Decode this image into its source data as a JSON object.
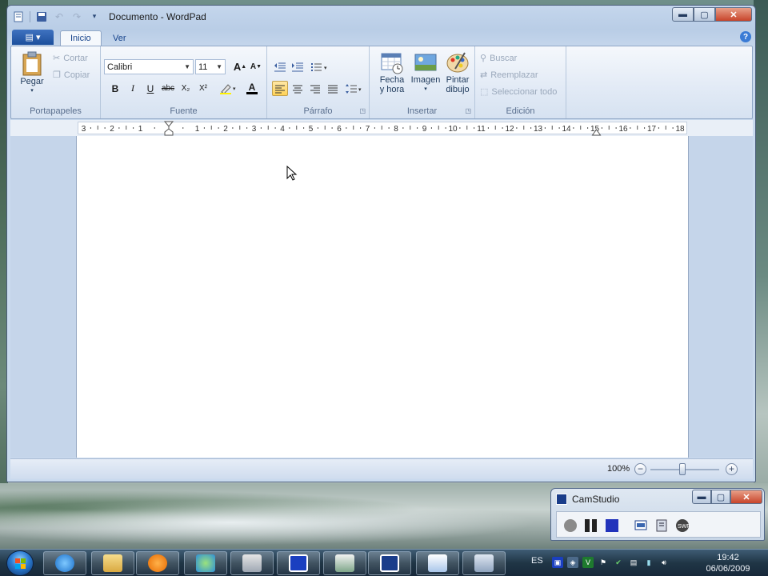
{
  "window": {
    "title": "Documento - WordPad",
    "controls": {
      "minimize": "▬",
      "maximize": "▢",
      "close": "✕"
    }
  },
  "quick_access": {
    "icons": [
      "wordpad-app-icon",
      "save-icon",
      "undo-icon",
      "redo-icon",
      "customize-qat-icon"
    ]
  },
  "tabs": {
    "app_menu": "▤ ▾",
    "items": [
      {
        "label": "Inicio",
        "active": true
      },
      {
        "label": "Ver",
        "active": false
      }
    ],
    "help": "?"
  },
  "ribbon": {
    "clipboard": {
      "label": "Portapapeles",
      "paste": "Pegar",
      "cut": "Cortar",
      "copy": "Copiar"
    },
    "font": {
      "label": "Fuente",
      "family": "Calibri",
      "size": "11",
      "grow": "A",
      "shrink": "A",
      "bold": "B",
      "italic": "I",
      "underline": "U",
      "strike": "abc",
      "subscript": "X₂",
      "superscript": "X²",
      "color_a": "A"
    },
    "paragraph": {
      "label": "Párrafo"
    },
    "insert": {
      "label": "Insertar",
      "datetime": "Fecha\ny hora",
      "datetime_l1": "Fecha",
      "datetime_l2": "y hora",
      "image": "Imagen",
      "paint_l1": "Pintar",
      "paint_l2": "dibujo"
    },
    "editing": {
      "label": "Edición",
      "find": "Buscar",
      "replace": "Reemplazar",
      "select_all": "Seleccionar todo"
    }
  },
  "ruler": {
    "numbers": [
      "3",
      "2",
      "1",
      "1",
      "2",
      "3",
      "4",
      "5",
      "6",
      "7",
      "8",
      "9",
      "10",
      "11",
      "12",
      "13",
      "14",
      "15",
      "16",
      "17",
      "18"
    ]
  },
  "status": {
    "zoom": "100%",
    "zoom_level": 1.0,
    "minus": "−",
    "plus": "+"
  },
  "camstudio": {
    "title": "CamStudio",
    "controls": {
      "minimize": "▬",
      "maximize": "▢",
      "close": "✕"
    }
  },
  "taskbar": {
    "language": "ES",
    "time": "19:42",
    "date": "06/06/2009"
  },
  "colors": {
    "title_bar": "#c4d6ec",
    "ribbon": "#e3ebf6",
    "accent": "#1c4f9c",
    "taskbar": "#203646"
  }
}
